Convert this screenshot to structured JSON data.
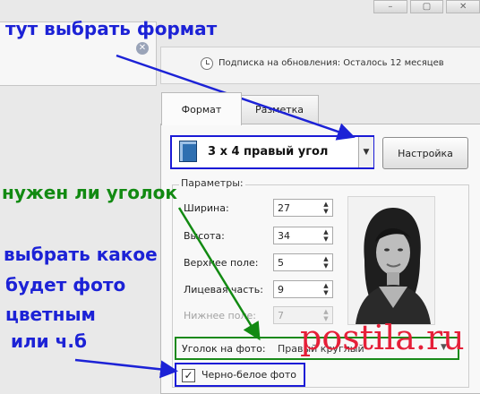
{
  "window": {
    "controls": [
      "–",
      "▢",
      "✕"
    ]
  },
  "subscription": {
    "text": "Подписка на обновления: Осталось 12 месяцев",
    "icon": "clock-icon"
  },
  "tabs": [
    {
      "label": "Формат",
      "active": true
    },
    {
      "label": "Разметка",
      "active": false
    }
  ],
  "format": {
    "selected": "3 x 4 правый угол",
    "icon": "photo-format-icon",
    "settings_label": "Настройка"
  },
  "params": {
    "group_label": "Параметры:",
    "fields": [
      {
        "label": "Ширина:",
        "value": "27",
        "disabled": false
      },
      {
        "label": "Высота:",
        "value": "34",
        "disabled": false
      },
      {
        "label": "Верхнее поле:",
        "value": "5",
        "disabled": false
      },
      {
        "label": "Лицевая часть:",
        "value": "9",
        "disabled": false
      },
      {
        "label": "Нижнее поле:",
        "value": "7",
        "disabled": true
      }
    ]
  },
  "corner": {
    "label": "Уголок на фото:",
    "value": "Правый круглый"
  },
  "bw": {
    "label": "Черно-белое фото",
    "checked": true
  },
  "annotations": {
    "choose_format": "тут выбрать формат",
    "need_corner": "нужен ли уголок",
    "choose_photo_1": "выбрать какое",
    "choose_photo_2": "будет фото",
    "choose_photo_3": "цветным",
    "choose_photo_4": "или ч.б"
  },
  "watermark": "postila.ru",
  "colors": {
    "annotation_blue": "#1c22d6",
    "annotation_green": "#128a12",
    "watermark_red": "#e51f38"
  }
}
